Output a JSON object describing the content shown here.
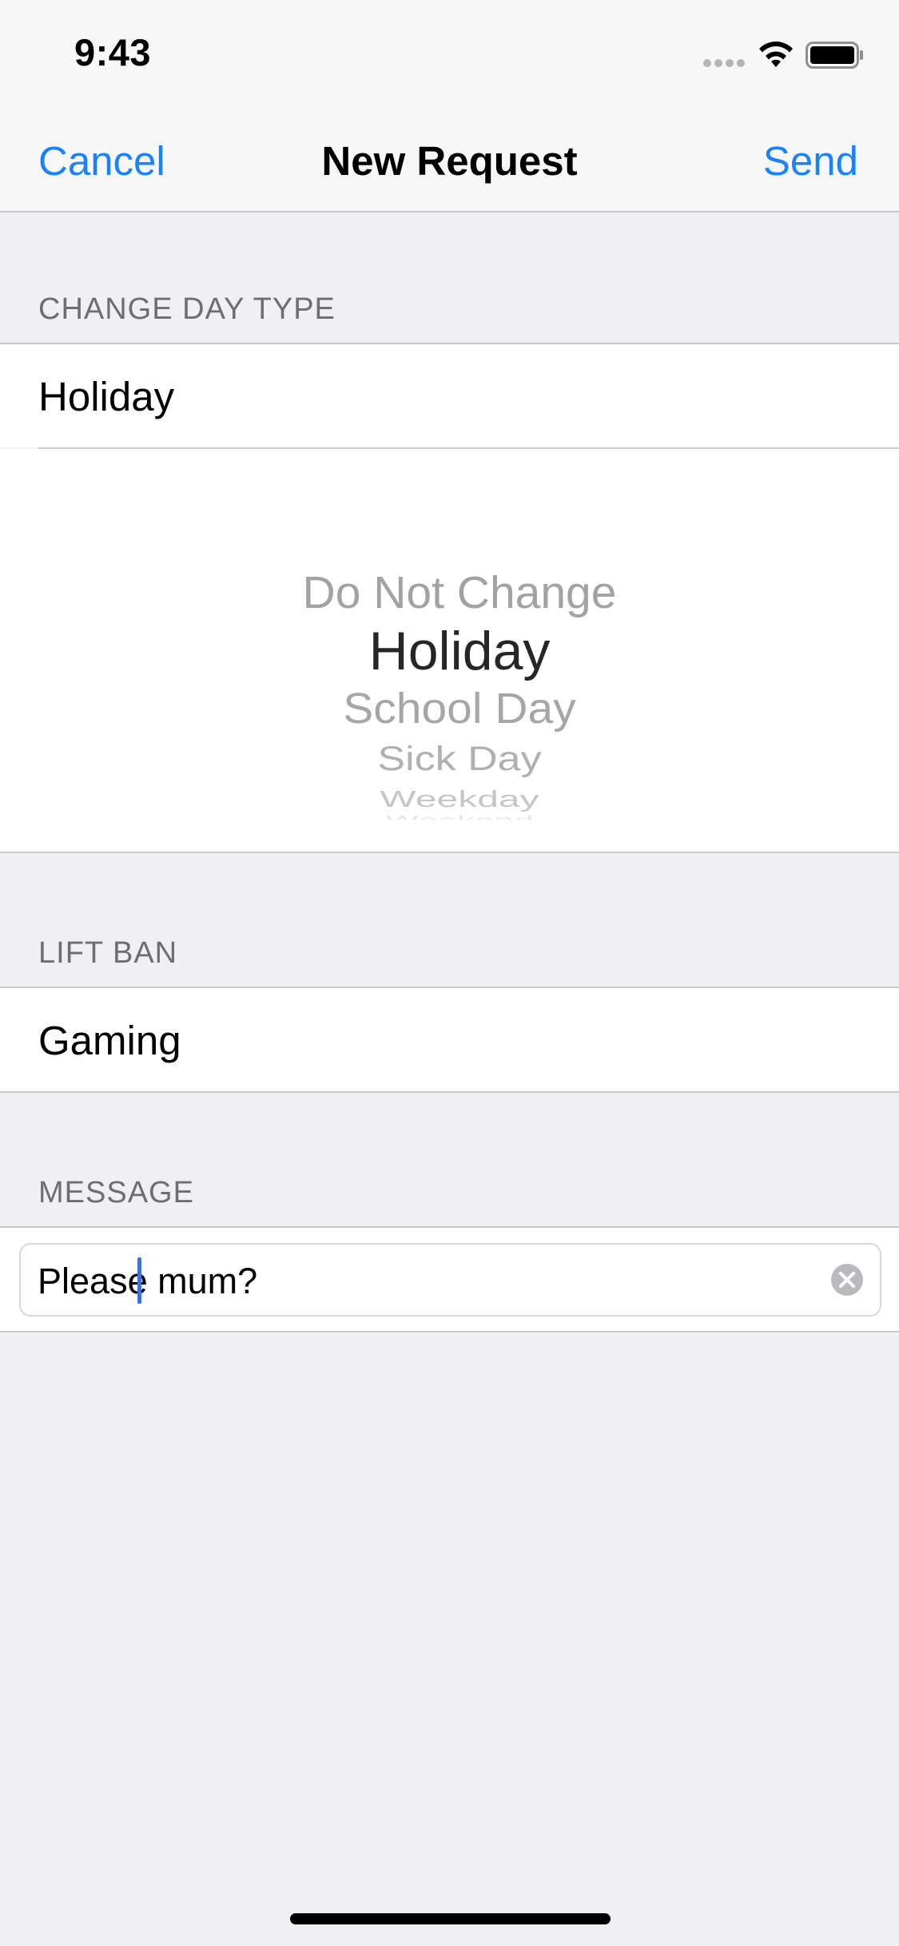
{
  "status_bar": {
    "time": "9:43"
  },
  "nav": {
    "cancel_label": "Cancel",
    "title": "New Request",
    "send_label": "Send"
  },
  "change_day_type": {
    "header": "CHANGE DAY TYPE",
    "selected_value": "Holiday",
    "picker_options": [
      "Do Not Change",
      "Holiday",
      "School Day",
      "Sick Day",
      "Weekday",
      "Weekend"
    ],
    "picker_selected": "Holiday"
  },
  "lift_ban": {
    "header": "LIFT BAN",
    "value": "Gaming"
  },
  "message": {
    "header": "MESSAGE",
    "value": "Please mum?"
  },
  "colors": {
    "accent": "#1a82fb",
    "background": "#efeff4",
    "caret": "#3b73d8"
  },
  "icons": [
    "signal-dots-icon",
    "wifi-icon",
    "battery-icon",
    "clear-text-icon"
  ]
}
